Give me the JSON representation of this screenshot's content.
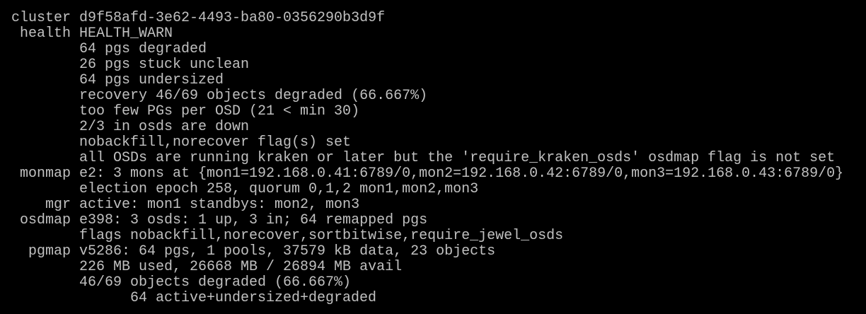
{
  "lines": [
    {
      "label": "cluster",
      "text": "d9f58afd-3e62-4493-ba80-0356290b3d9f"
    },
    {
      "label": "health",
      "text": "HEALTH_WARN"
    },
    {
      "label": "",
      "text": "64 pgs degraded"
    },
    {
      "label": "",
      "text": "26 pgs stuck unclean"
    },
    {
      "label": "",
      "text": "64 pgs undersized"
    },
    {
      "label": "",
      "text": "recovery 46/69 objects degraded (66.667%)"
    },
    {
      "label": "",
      "text": "too few PGs per OSD (21 < min 30)"
    },
    {
      "label": "",
      "text": "2/3 in osds are down"
    },
    {
      "label": "",
      "text": "nobackfill,norecover flag(s) set"
    },
    {
      "label": "",
      "text": "all OSDs are running kraken or later but the 'require_kraken_osds' osdmap flag is not set"
    },
    {
      "label": "monmap",
      "text": "e2: 3 mons at {mon1=192.168.0.41:6789/0,mon2=192.168.0.42:6789/0,mon3=192.168.0.43:6789/0}"
    },
    {
      "label": "",
      "text": "election epoch 258, quorum 0,1,2 mon1,mon2,mon3"
    },
    {
      "label": "mgr",
      "text": "active: mon1 standbys: mon2, mon3"
    },
    {
      "label": "osdmap",
      "text": "e398: 3 osds: 1 up, 3 in; 64 remapped pgs"
    },
    {
      "label": "",
      "text": "flags nobackfill,norecover,sortbitwise,require_jewel_osds"
    },
    {
      "label": "pgmap",
      "text": "v5286: 64 pgs, 1 pools, 37579 kB data, 23 objects"
    },
    {
      "label": "",
      "text": "226 MB used, 26668 MB / 26894 MB avail"
    },
    {
      "label": "",
      "text": "46/69 objects degraded (66.667%)"
    },
    {
      "label": "",
      "text": "64 active+undersized+degraded"
    }
  ]
}
